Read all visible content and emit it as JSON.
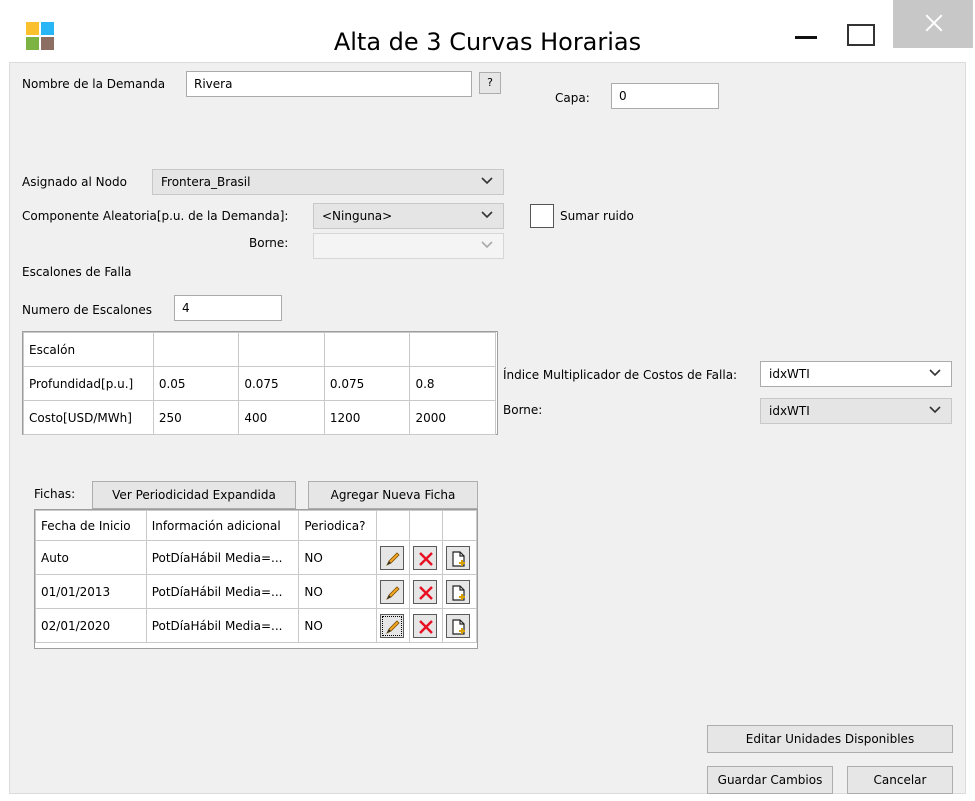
{
  "window": {
    "title": "Alta de 3 Curvas Horarias"
  },
  "demanda": {
    "nombre_label": "Nombre de la Demanda",
    "nombre_value": "Rivera",
    "help_label": "?",
    "capa_label": "Capa:",
    "capa_value": "0"
  },
  "nodo": {
    "label": "Asignado al Nodo",
    "value": "Frontera_Brasil"
  },
  "componente": {
    "label": "Componente Aleatoria[p.u. de la Demanda]:",
    "value": "<Ninguna>",
    "sumar_ruido_label": "Sumar ruido",
    "borne_label": "Borne:",
    "borne_value": ""
  },
  "escalones": {
    "section_label": "Escalones de Falla",
    "numero_label": "Numero de Escalones",
    "numero_value": "4",
    "header": "Escalón",
    "rows": [
      {
        "label": "Profundidad[p.u.]",
        "values": [
          "0.05",
          "0.075",
          "0.075",
          "0.8"
        ]
      },
      {
        "label": "Costo[USD/MWh]",
        "values": [
          "250",
          "400",
          "1200",
          "2000"
        ]
      }
    ]
  },
  "indice": {
    "label": "Índice Multiplicador de Costos de Falla:",
    "value": "idxWTI",
    "borne_label": "Borne:",
    "borne_value": "idxWTI"
  },
  "fichas": {
    "label": "Fichas:",
    "ver_button": "Ver Periodicidad Expandida",
    "agregar_button": "Agregar Nueva Ficha",
    "headers": [
      "Fecha de Inicio",
      "Información adicional",
      "Periodica?"
    ],
    "rows": [
      {
        "fecha": "Auto",
        "info": "PotDíaHábil Media=...",
        "periodica": "NO"
      },
      {
        "fecha": "01/01/2013",
        "info": "PotDíaHábil Media=...",
        "periodica": "NO"
      },
      {
        "fecha": "02/01/2020",
        "info": "PotDíaHábil Media=...",
        "periodica": "NO"
      }
    ]
  },
  "footer": {
    "editar_button": "Editar Unidades Disponibles",
    "guardar_button": "Guardar Cambios",
    "cancelar_button": "Cancelar"
  },
  "colors": {
    "accent_red": "#e81123",
    "icon_green": "#7cb342",
    "icon_blue": "#29b6f6",
    "icon_yellow": "#fbc02d",
    "icon_brown": "#8d6e63"
  }
}
